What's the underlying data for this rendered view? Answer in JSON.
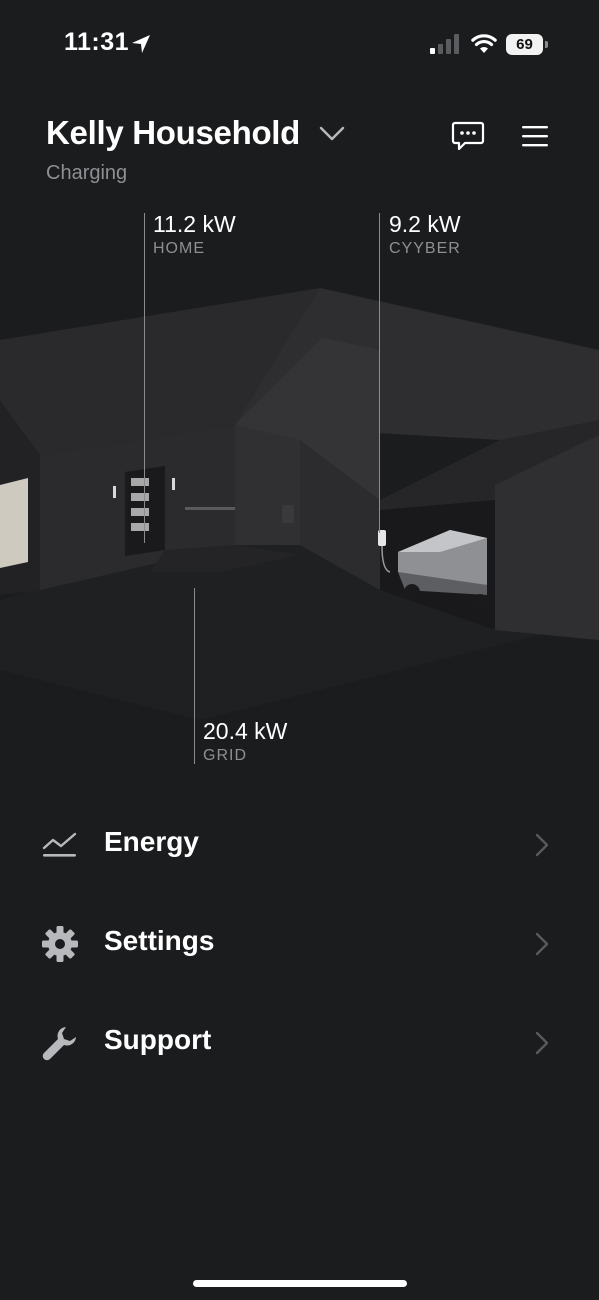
{
  "status_bar": {
    "time": "11:31",
    "battery_level": "69",
    "icons": [
      "location-arrow-icon",
      "cellular-signal-icon",
      "wifi-icon",
      "battery-icon"
    ]
  },
  "header": {
    "site_name": "Kelly Household",
    "status": "Charging",
    "icons": [
      "chevron-down-icon",
      "chat-icon",
      "menu-icon"
    ]
  },
  "power_flow": {
    "home": {
      "value": "11.2 kW",
      "label": "HOME"
    },
    "vehicle": {
      "value": "9.2 kW",
      "label": "CYYBER"
    },
    "grid": {
      "value": "20.4 kW",
      "label": "GRID"
    }
  },
  "nav": {
    "items": [
      {
        "label": "Energy",
        "icon": "energy-chart-icon"
      },
      {
        "label": "Settings",
        "icon": "gear-icon"
      },
      {
        "label": "Support",
        "icon": "wrench-icon"
      }
    ]
  },
  "colors": {
    "background": "#1b1c1e",
    "text_primary": "#ffffff",
    "text_secondary": "#8e8f93"
  }
}
